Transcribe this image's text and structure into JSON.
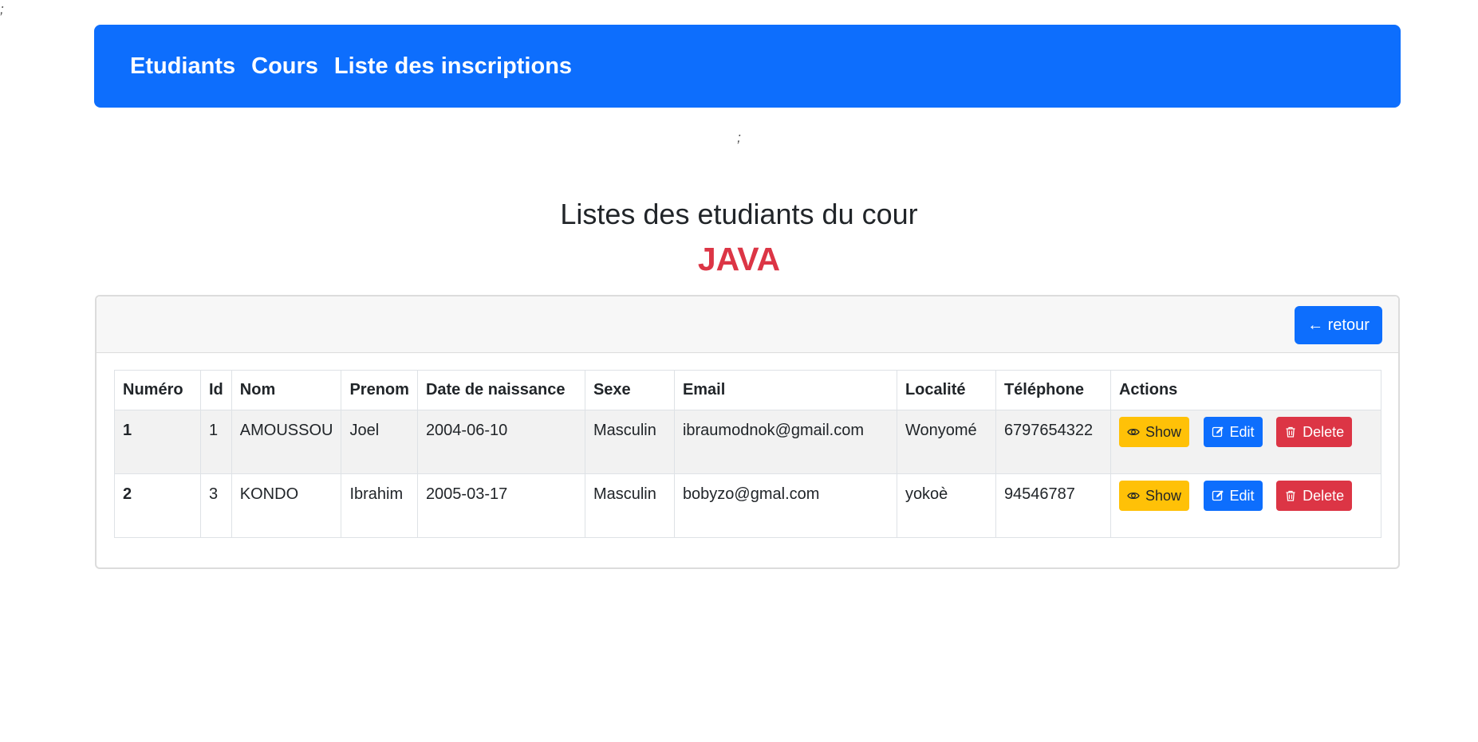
{
  "stray_text_top": ";",
  "stray_text_mid": ";",
  "navbar": {
    "items": [
      "Etudiants",
      "Cours",
      "Liste des inscriptions"
    ],
    "color": "#0d6efd"
  },
  "page": {
    "title": "Listes des etudiants du cour",
    "course": "JAVA",
    "course_color": "#dc3545"
  },
  "card": {
    "back_button": "← retour"
  },
  "table": {
    "headers": [
      "Numéro",
      "Id",
      "Nom",
      "Prenom",
      "Date de naissance",
      "Sexe",
      "Email",
      "Localité",
      "Téléphone",
      "Actions"
    ],
    "rows": [
      {
        "numero": "1",
        "id": "1",
        "nom": "AMOUSSOU",
        "prenom": "Joel",
        "date": "2004-06-10",
        "sexe": "Masculin",
        "email": "ibraumodnok@gmail.com",
        "localite": "Wonyomé",
        "telephone": "6797654322"
      },
      {
        "numero": "2",
        "id": "3",
        "nom": "KONDO",
        "prenom": "Ibrahim",
        "date": "2005-03-17",
        "sexe": "Masculin",
        "email": "bobyzo@gmal.com",
        "localite": "yokoè",
        "telephone": "94546787"
      }
    ],
    "actions": {
      "show": "Show",
      "edit": "Edit",
      "delete": "Delete"
    }
  },
  "icons": {
    "show": "eye-icon",
    "edit": "edit-icon",
    "delete": "trash-icon"
  },
  "colors": {
    "show": "#ffc107",
    "edit": "#0d6efd",
    "delete": "#dc3545"
  }
}
